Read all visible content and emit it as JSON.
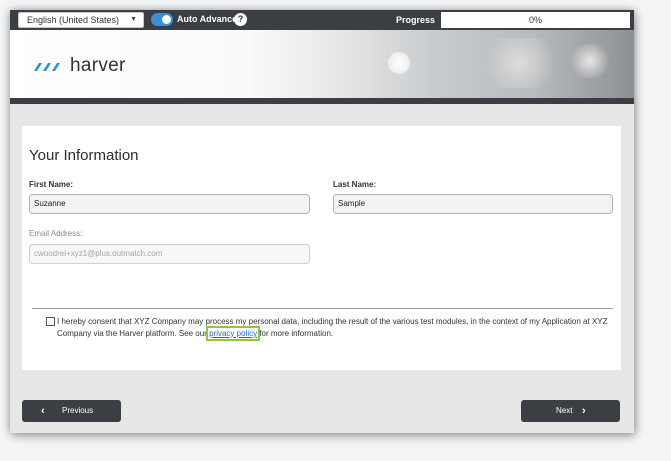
{
  "topbar": {
    "language": "English (United States)",
    "auto_advance_label": "Auto Advance",
    "auto_advance_on": true,
    "help_symbol": "?",
    "progress_label": "Progress",
    "progress_value": "0%",
    "progress_fraction": 0
  },
  "banner": {
    "logo_text": "harver",
    "logo_icon": "harver-logo-icon"
  },
  "form": {
    "title": "Your Information",
    "first_name_label": "First Name:",
    "first_name_value": "Suzanne",
    "last_name_label": "Last Name:",
    "last_name_value": "Sample",
    "email_label": "Email Address:",
    "email_value": "cwoodrel+xyz1@plus.outmatch.com",
    "consent_before": "I hereby consent that XYZ Company may process my personal data, including the result of the various test modules, in the context of my Application at XYZ Company via the Harver platform. See our ",
    "consent_link": "privacy policy",
    "consent_after": " for more information."
  },
  "nav": {
    "previous_label": "Previous",
    "next_label": "Next"
  },
  "colors": {
    "accent": "#3a8fd6",
    "dark": "#3b3e42",
    "link": "#2b6cb0",
    "highlight": "#8dc63f",
    "logo_blue": "#2a8fd4"
  }
}
